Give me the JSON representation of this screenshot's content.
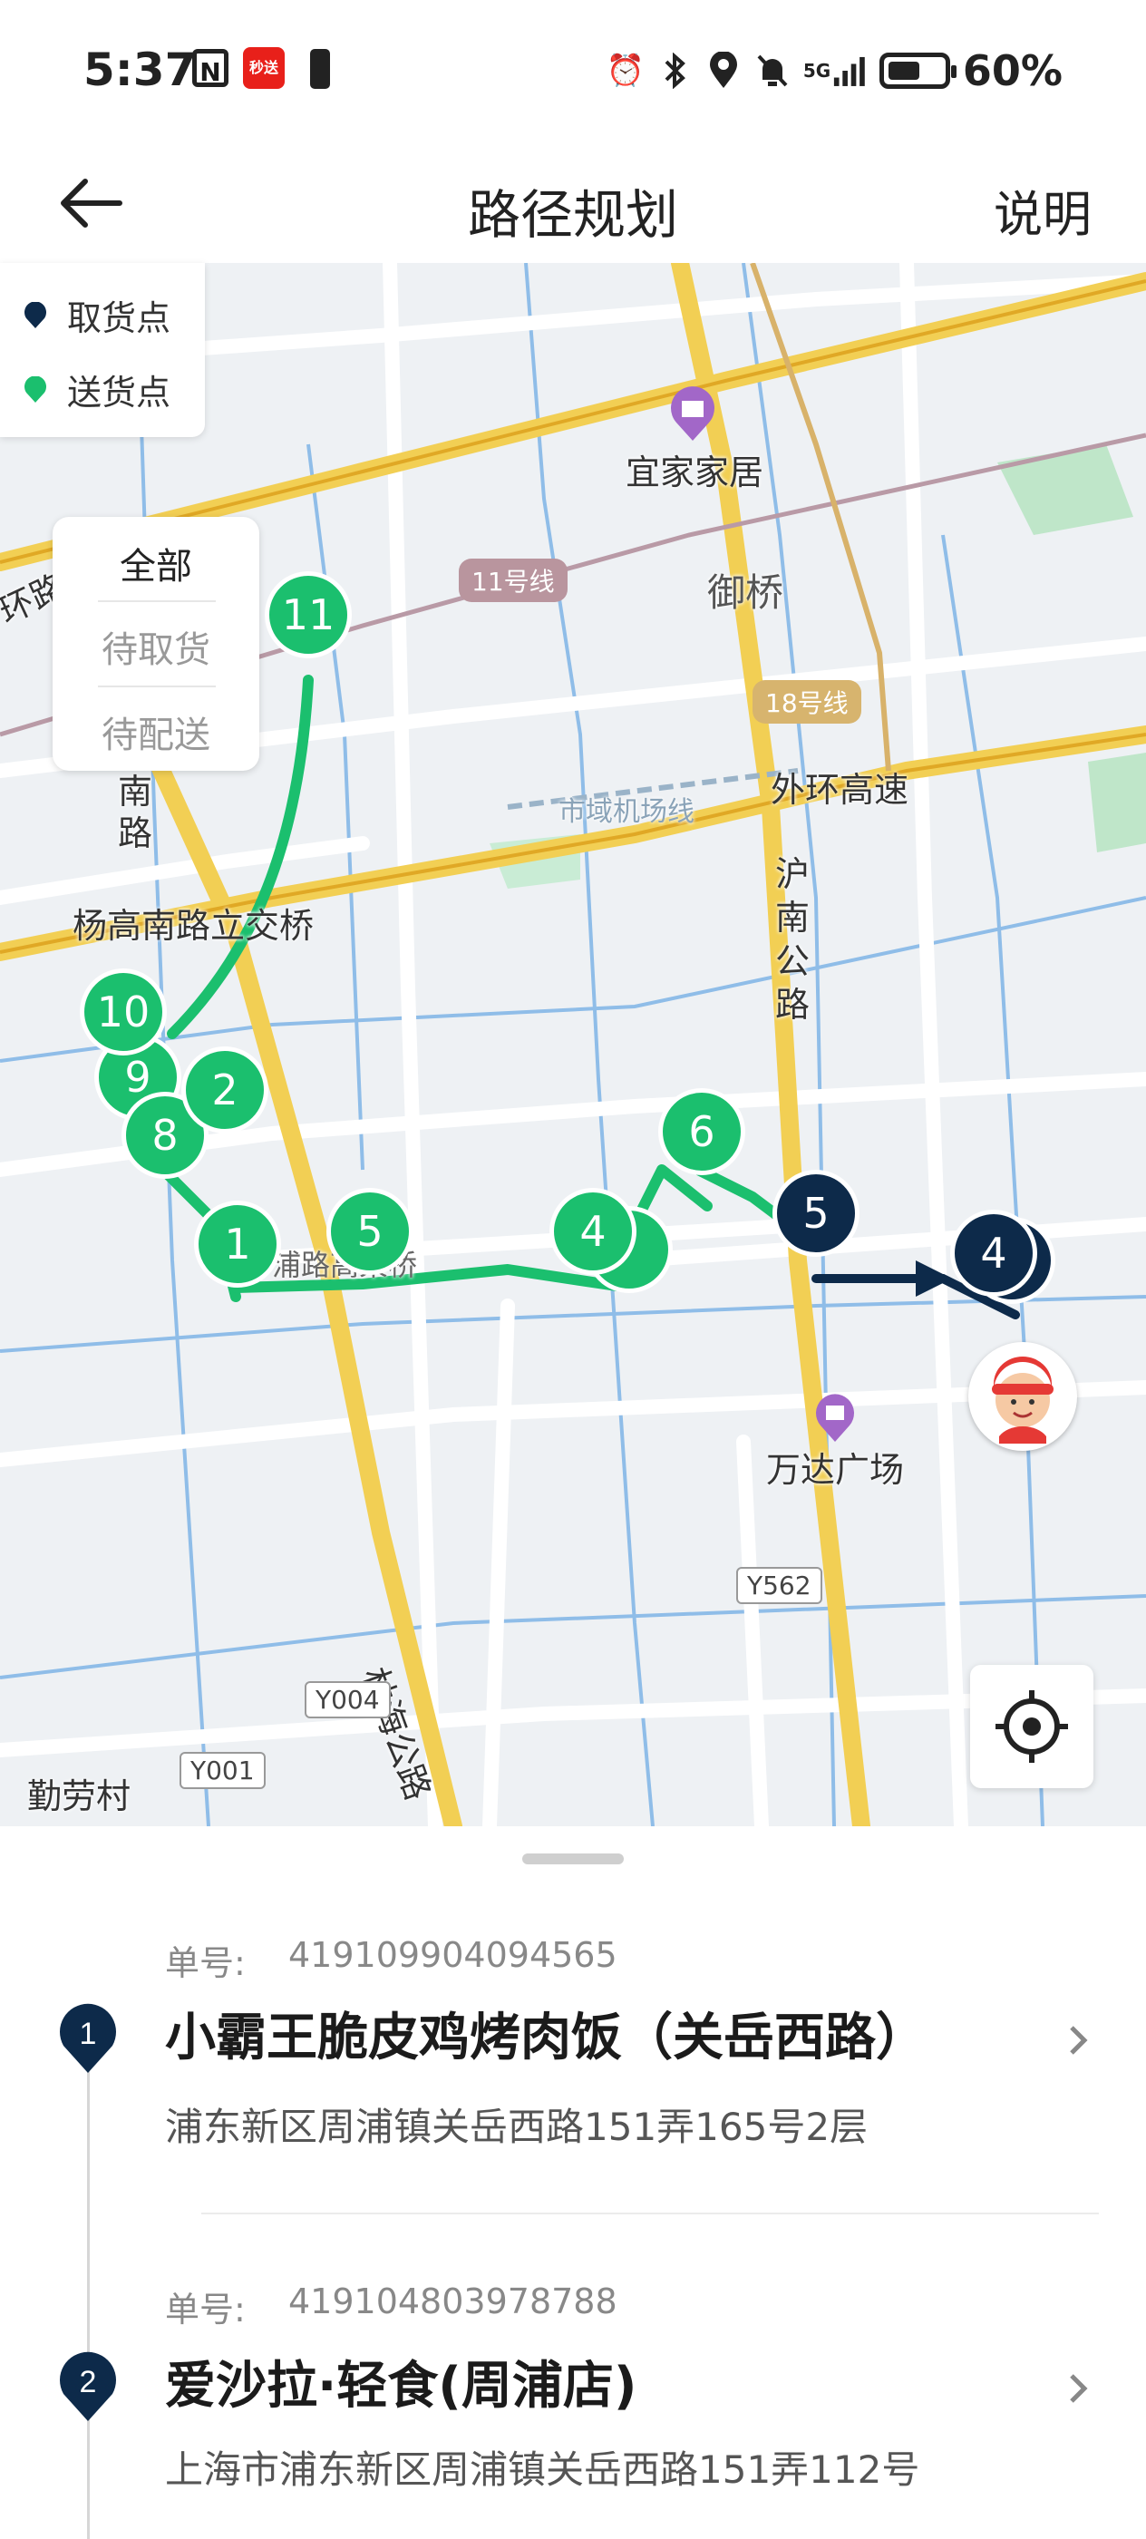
{
  "status_bar": {
    "time": "5:37",
    "nfc": "N",
    "app_badge": "秒送",
    "network": "5G",
    "battery": "60%",
    "icons": [
      "alarm-icon",
      "bluetooth-icon",
      "location-icon",
      "mute-icon",
      "signal-icon",
      "battery-icon"
    ]
  },
  "header": {
    "title": "路径规划",
    "right_action": "说明",
    "back_icon": "arrow-left-icon"
  },
  "legend": {
    "pickup": "取货点",
    "delivery": "送货点",
    "pickup_color": "#0d2a4a",
    "delivery_color": "#1bbf6e"
  },
  "filter": {
    "options": [
      "全部",
      "待取货",
      "待配送"
    ],
    "selected": "全部"
  },
  "map": {
    "labels": {
      "yijia": "宜家家居",
      "yuqiao": "御桥",
      "waihuan": "外环高速",
      "hunan": "沪南公路",
      "yanggao_bridge": "杨高南路立交桥",
      "yanggao": "南路",
      "wanda": "万达广场",
      "linhai": "林海公路",
      "qinlao": "勤劳村",
      "shiyu": "市域机场线",
      "lu_left": "环路",
      "guanyue": "浦路高架桥"
    },
    "line_tags": {
      "line11": "11号线",
      "line18": "18号线"
    },
    "road_tags": {
      "y562": "Y562",
      "y004": "Y004",
      "y001": "Y001"
    },
    "markers_delivery": [
      "11",
      "10",
      "9",
      "8",
      "2",
      "1",
      "5",
      "6",
      "4"
    ],
    "markers_pickup": [
      "5",
      "4"
    ]
  },
  "orders": [
    {
      "index": "1",
      "label": "单号:",
      "number": "419109904094565",
      "name": "小霸王脆皮鸡烤肉饭（关岳西路）",
      "address": "浦东新区周浦镇关岳西路151弄165号2层"
    },
    {
      "index": "2",
      "label": "单号:",
      "number": "419104803978788",
      "name": "爱沙拉·轻食(周浦店)",
      "address": "上海市浦东新区周浦镇关岳西路151弄112号"
    }
  ]
}
